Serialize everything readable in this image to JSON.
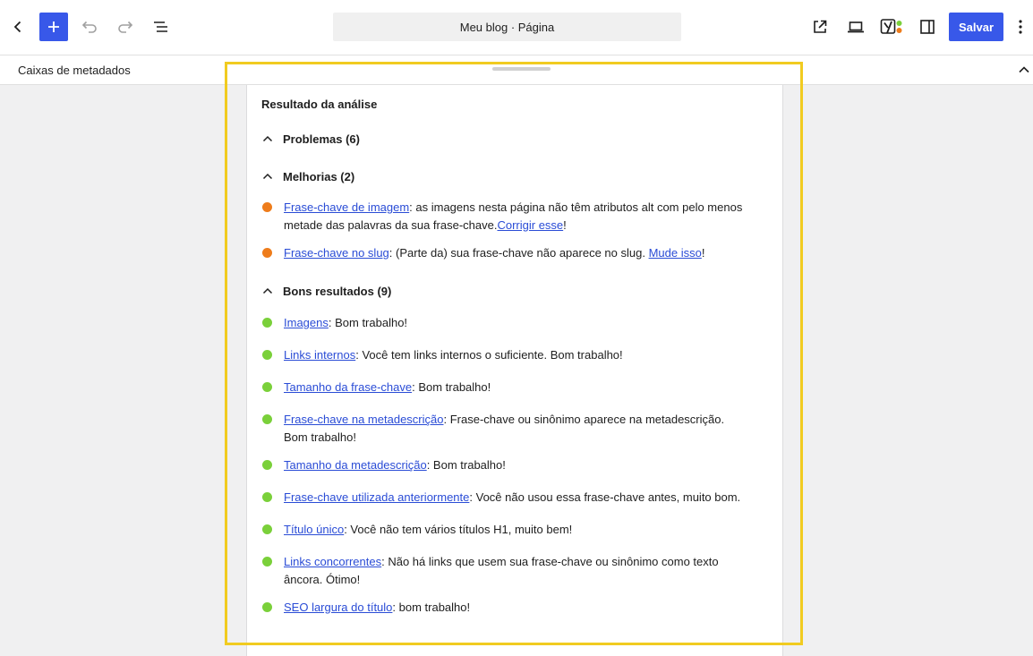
{
  "colors": {
    "accent": "#3858e9",
    "improvement": "#ee7c1b",
    "good": "#7ad03a",
    "link": "#2a4cd6",
    "highlight": "#f1cb20"
  },
  "toolbar": {
    "document_title": "Meu blog · Página",
    "save_label": "Salvar",
    "icons": [
      "chevron-left-icon",
      "plus-icon",
      "undo-icon",
      "redo-icon",
      "list-view-icon",
      "external-link-icon",
      "laptop-icon",
      "yoast-icon",
      "sidebar-icon",
      "more-vertical-icon"
    ]
  },
  "metabox": {
    "title": "Caixas de metadados"
  },
  "analysis": {
    "heading": "Resultado da análise",
    "problems_label": "Problemas (6)",
    "improvements_label": "Melhorias (2)",
    "good_label": "Bons resultados (9)",
    "improvements": [
      {
        "link": "Frase-chave de imagem",
        "text": ": as imagens nesta página não têm atributos alt com pelo menos metade das palavras da sua frase-chave.",
        "link2": "Corrigir esse",
        "tail": "!"
      },
      {
        "link": "Frase-chave no slug",
        "text": ": (Parte da) sua frase-chave não aparece no slug. ",
        "link2": "Mude isso",
        "tail": "!"
      }
    ],
    "good": [
      {
        "link": "Imagens",
        "text": ": Bom trabalho!"
      },
      {
        "link": "Links internos",
        "text": ": Você tem links internos o suficiente. Bom trabalho!"
      },
      {
        "link": "Tamanho da frase-chave",
        "text": ": Bom trabalho!"
      },
      {
        "link": "Frase-chave na metadescrição",
        "text": ": Frase-chave ou sinônimo aparece na metadescrição. Bom trabalho!"
      },
      {
        "link": "Tamanho da metadescrição",
        "text": ": Bom trabalho!"
      },
      {
        "link": "Frase-chave utilizada anteriormente",
        "text": ": Você não usou essa frase-chave antes, muito bom."
      },
      {
        "link": "Título único",
        "text": ": Você não tem vários títulos H1, muito bem!"
      },
      {
        "link": "Links concorrentes",
        "text": ": Não há links que usem sua frase-chave ou sinônimo como texto âncora. Ótimo!"
      },
      {
        "link": "SEO largura do título",
        "text": ": bom trabalho!"
      }
    ]
  }
}
